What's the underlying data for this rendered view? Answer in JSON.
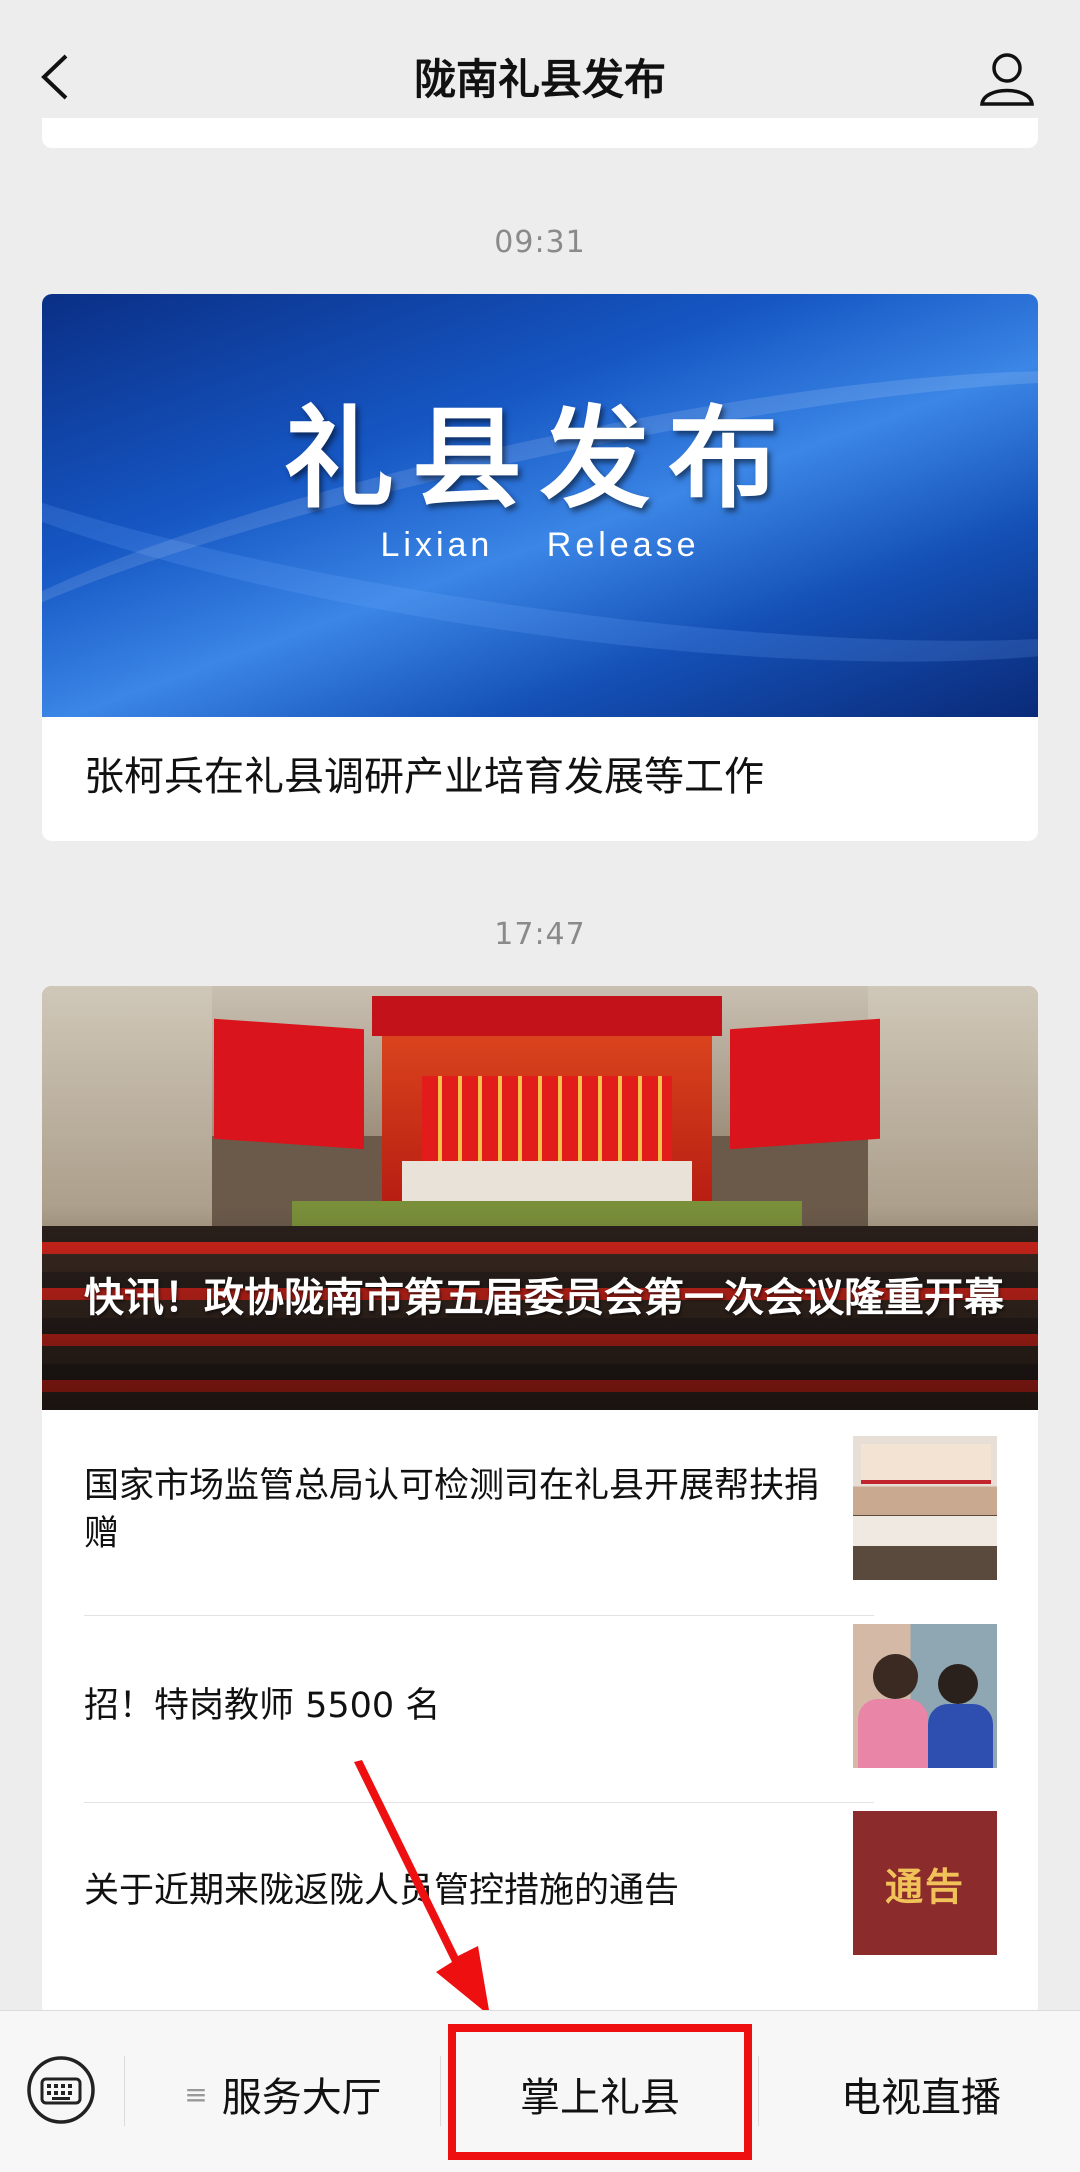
{
  "header": {
    "title": "陇南礼县发布"
  },
  "feed": [
    {
      "time": "09:31",
      "banner": {
        "title": "礼县发布",
        "subtitle": "Lixian    Release"
      },
      "headline": "张柯兵在礼县调研产业培育发展等工作"
    },
    {
      "time": "17:47",
      "hero_headline": "快讯！政协陇南市第五届委员会第一次会议隆重开幕",
      "items": [
        {
          "title": "国家市场监管总局认可检测司在礼县开展帮扶捐赠",
          "thumb": "meeting-photo"
        },
        {
          "title": "招！特岗教师 5500 名",
          "thumb": "classroom-photo"
        },
        {
          "title": "关于近期来陇返陇人员管控措施的通告",
          "thumb": "notice-image",
          "thumb_text": "通告"
        }
      ]
    }
  ],
  "bottom_nav": {
    "items": [
      {
        "label": "服务大厅"
      },
      {
        "label": "掌上礼县"
      },
      {
        "label": "电视直播"
      }
    ],
    "menu_glyph": "≡"
  },
  "annotation": {
    "color": "#ee1010"
  }
}
